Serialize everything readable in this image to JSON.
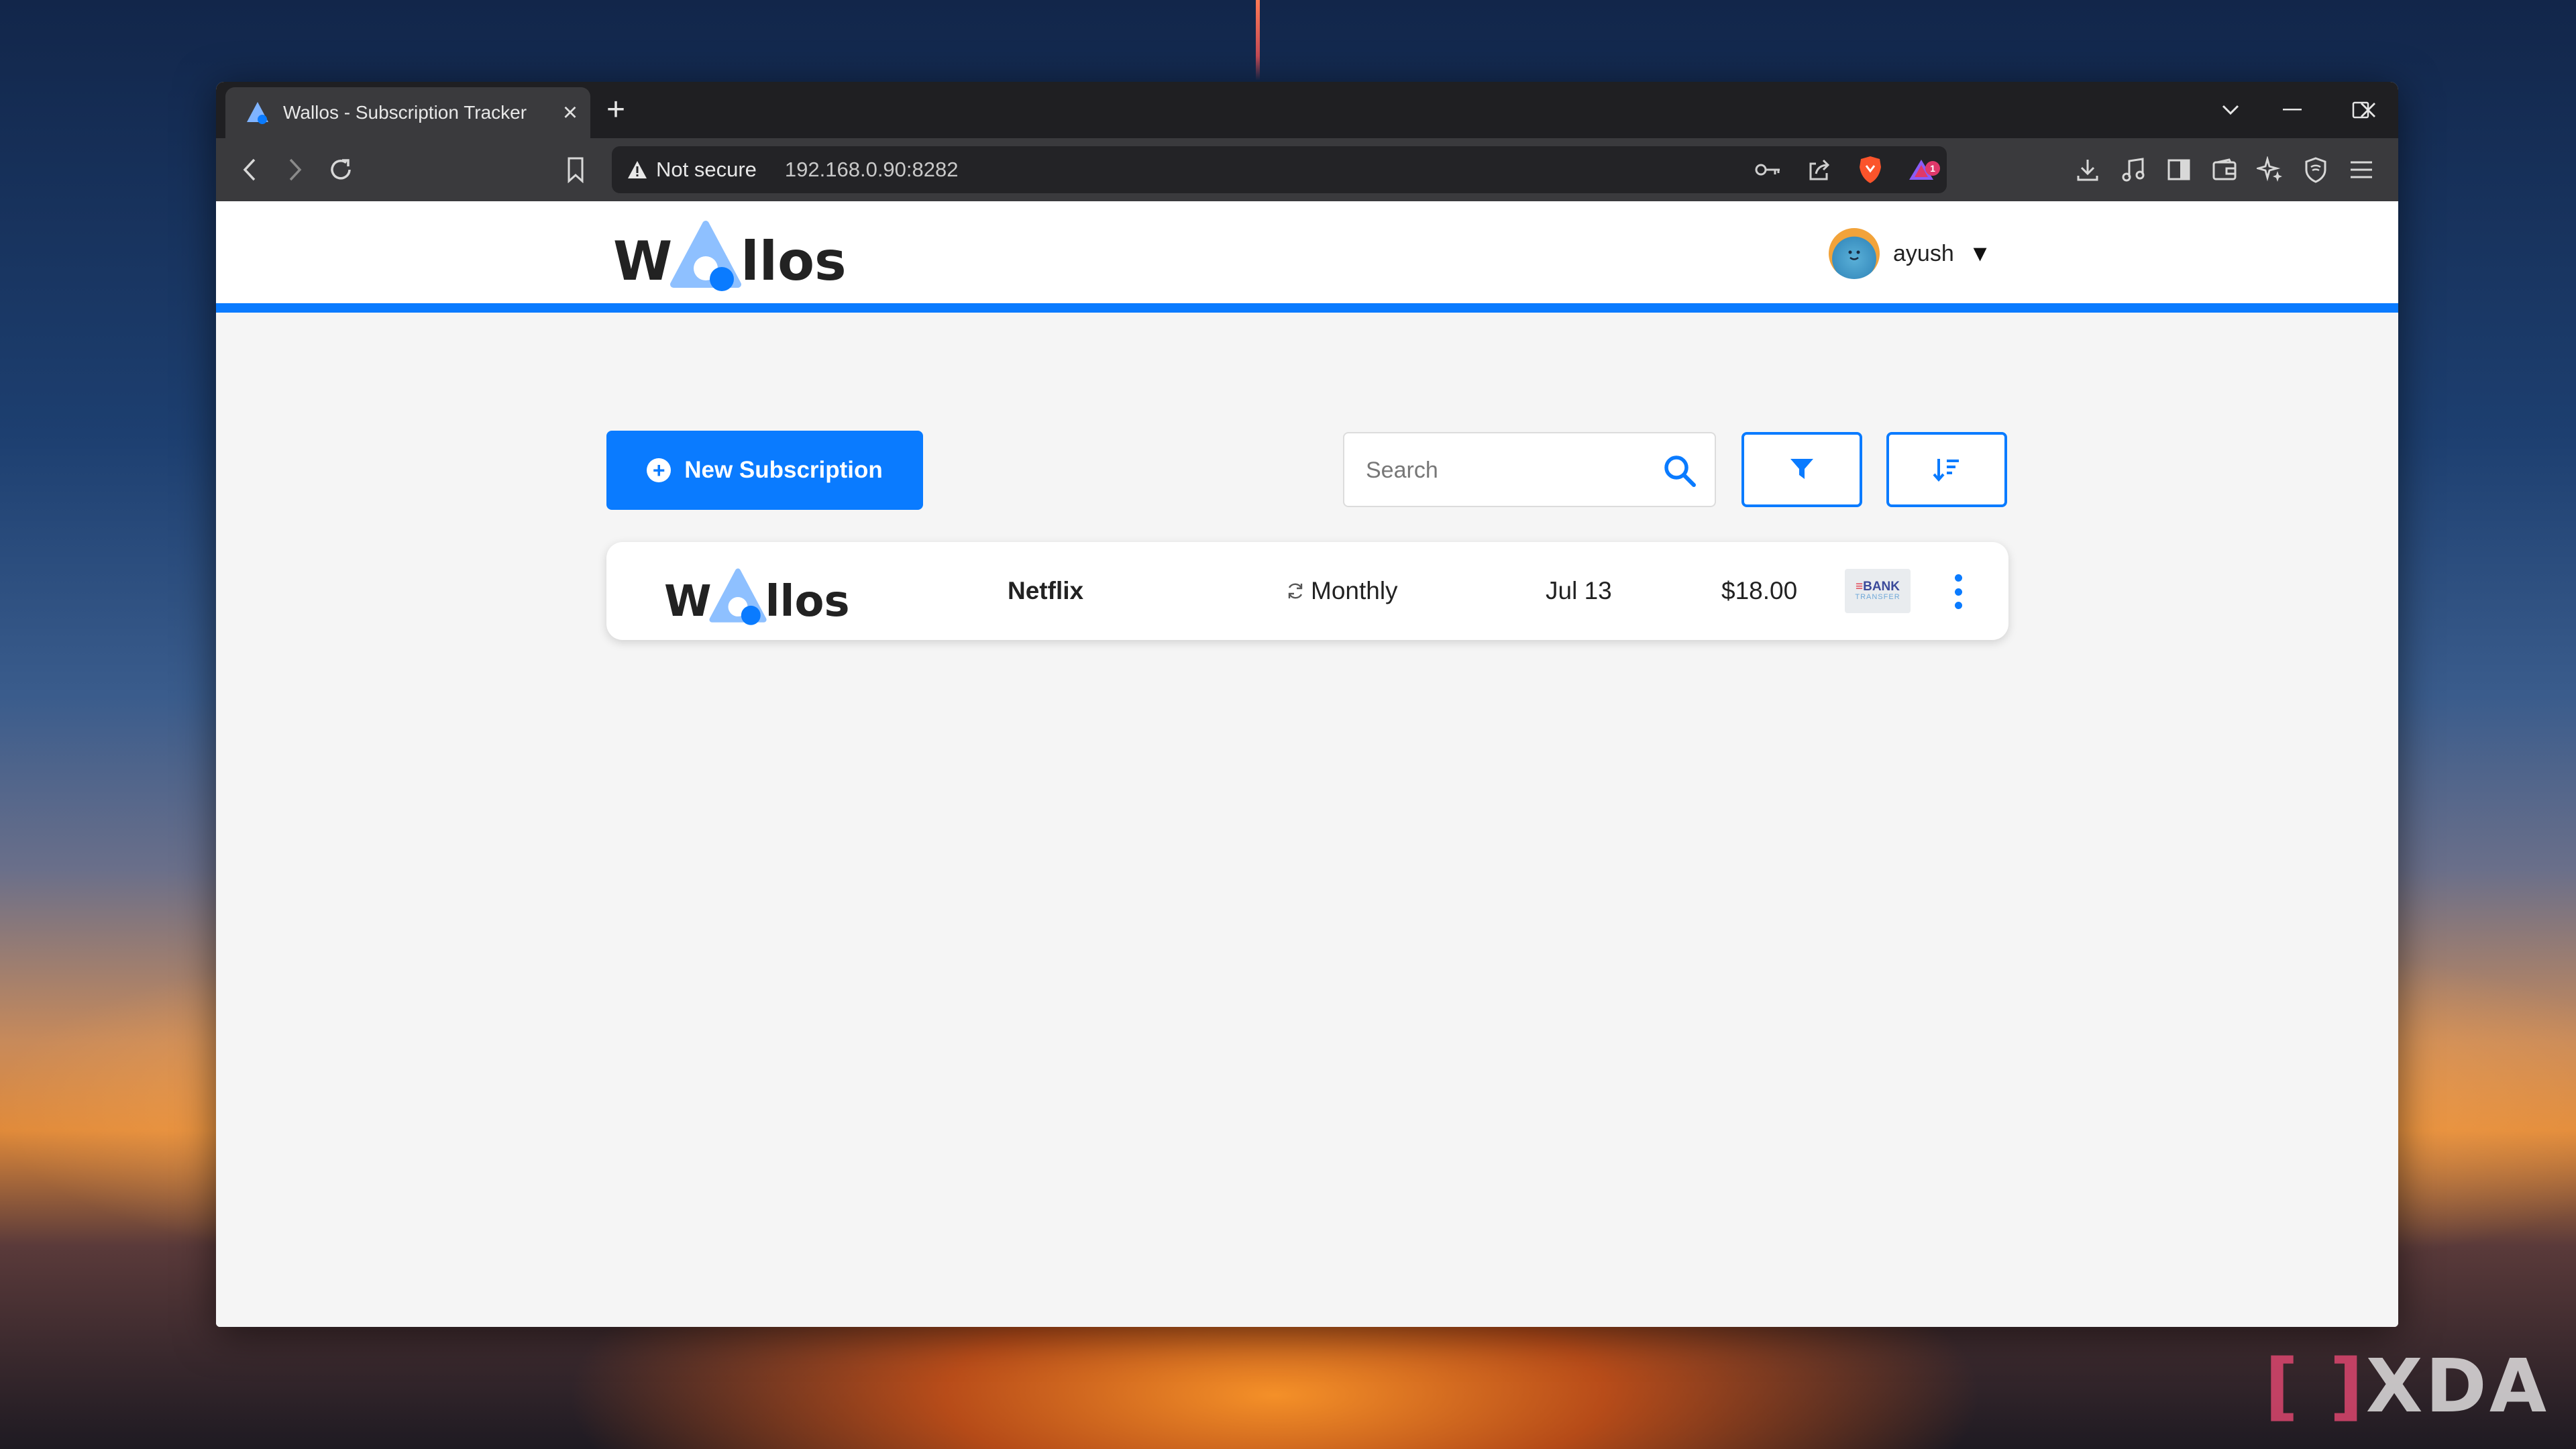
{
  "browser": {
    "tab_title": "Wallos - Subscription Tracker",
    "security_label": "Not secure",
    "url": "192.168.0.90:8282",
    "shields_badge": "1"
  },
  "app": {
    "logo_text_left": "W",
    "logo_text_right": "llos",
    "user_name": "ayush",
    "new_subscription_label": "New Subscription",
    "search_placeholder": "Search",
    "accent_color": "#0a7bff"
  },
  "subscriptions": [
    {
      "logo_text_left": "W",
      "logo_text_right": "llos",
      "name": "Netflix",
      "cycle": "Monthly",
      "next_payment": "Jul 13",
      "price": "$18.00",
      "payment_method": {
        "line1": "BANK",
        "line2": "TRANSFER"
      }
    }
  ],
  "watermark": "XDA"
}
